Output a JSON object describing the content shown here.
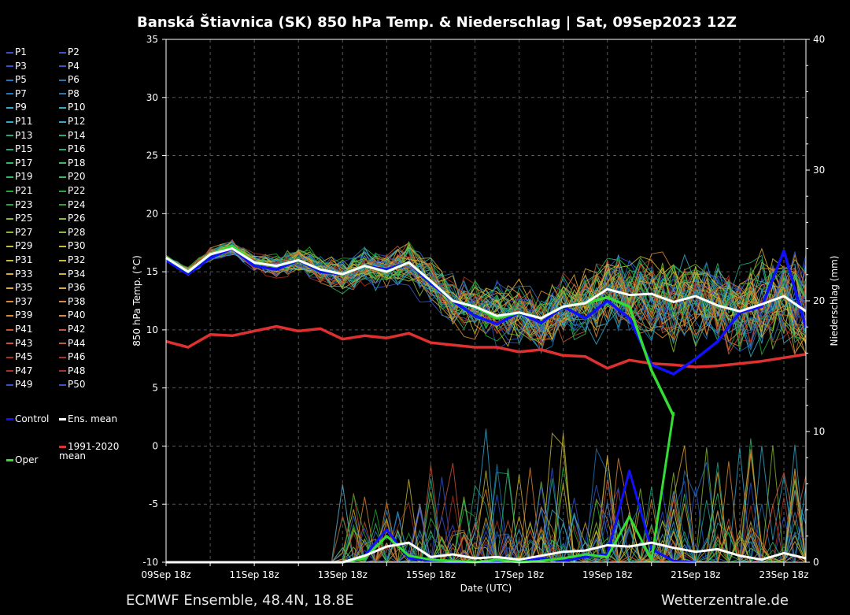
{
  "title": "Banská Štiavnica  (SK)  850 hPa Temp. & Niederschlag | Sat, 09Sep2023 12Z",
  "footer": {
    "left": "ECMWF Ensemble, 48.4N, 18.8E",
    "right": "Wetterzentrale.de"
  },
  "legend": {
    "members": [
      "P1",
      "P2",
      "P3",
      "P4",
      "P5",
      "P6",
      "P7",
      "P8",
      "P9",
      "P10",
      "P11",
      "P12",
      "P13",
      "P14",
      "P15",
      "P16",
      "P17",
      "P18",
      "P19",
      "P20",
      "P21",
      "P22",
      "P23",
      "P24",
      "P25",
      "P26",
      "P27",
      "P28",
      "P29",
      "P30",
      "P31",
      "P32",
      "P33",
      "P34",
      "P35",
      "P36",
      "P37",
      "P38",
      "P39",
      "P40",
      "P41",
      "P42",
      "P43",
      "P44",
      "P45",
      "P46",
      "P47",
      "P48",
      "P49",
      "P50"
    ],
    "control": "Control",
    "ens_mean": "Ens. mean",
    "clim_mean": "1991-2020 mean",
    "oper": "Oper"
  },
  "colors": {
    "control": "#1010ff",
    "ens_mean": "#ffffff",
    "clim": "#e03030",
    "oper": "#33dd33",
    "members": [
      "#3355cc",
      "#2277bb",
      "#33aacc",
      "#22aa88",
      "#33bb66",
      "#22aa33",
      "#88bb33",
      "#ccbb33",
      "#ddaa33",
      "#dd8833",
      "#cc5533",
      "#aa3322"
    ]
  },
  "chart_data": {
    "type": "line",
    "x_ticks": [
      "09Sep 18z",
      "11Sep 18z",
      "13Sep 18z",
      "15Sep 18z",
      "17Sep 18z",
      "19Sep 18z",
      "21Sep 18z",
      "23Sep 18z"
    ],
    "xlabel": "Date (UTC)",
    "ylabel_left": "850 hPa Temp. (°C)",
    "ylabel_right": "Niederschlag (mm)",
    "ylim_left": [
      -10,
      35
    ],
    "ylim_right": [
      0,
      40
    ],
    "yticks_left": [
      -10,
      -5,
      0,
      5,
      10,
      15,
      20,
      25,
      30,
      35
    ],
    "yticks_right": [
      0,
      10,
      20,
      30,
      40
    ],
    "x_range_days": [
      0,
      14.5
    ],
    "grid": true,
    "series": [
      {
        "name": "Ens. mean",
        "axis": "left",
        "x": [
          0,
          0.5,
          1,
          1.5,
          2,
          2.5,
          3,
          3.5,
          4,
          4.5,
          5,
          5.5,
          6,
          6.5,
          7,
          7.5,
          8,
          8.5,
          9,
          9.5,
          10,
          10.5,
          11,
          11.5,
          12,
          12.5,
          13,
          13.5,
          14,
          14.5
        ],
        "values": [
          16.2,
          15.0,
          16.5,
          17.0,
          15.8,
          15.5,
          16.0,
          15.2,
          14.8,
          15.5,
          15.0,
          15.8,
          14.2,
          12.5,
          12.0,
          11.2,
          11.5,
          11.0,
          12.0,
          12.3,
          13.5,
          13.0,
          13.1,
          12.4,
          12.9,
          12.1,
          11.6,
          12.2,
          12.9,
          11.6
        ]
      },
      {
        "name": "Control",
        "axis": "left",
        "x": [
          0,
          0.5,
          1,
          1.5,
          2,
          2.5,
          3,
          3.5,
          4,
          4.5,
          5,
          5.5,
          6,
          6.5,
          7,
          7.5,
          8,
          8.5,
          9,
          9.5,
          10,
          10.5,
          11,
          11.5,
          12,
          12.5,
          13,
          13.5,
          14,
          14.5
        ],
        "values": [
          16.0,
          14.8,
          16.2,
          17.0,
          15.5,
          15.2,
          16.0,
          15.0,
          14.8,
          15.5,
          15.2,
          15.8,
          14.0,
          12.5,
          11.2,
          10.5,
          11.5,
          10.6,
          12.0,
          11.0,
          12.5,
          11.0,
          7.0,
          6.2,
          7.5,
          9.0,
          11.5,
          12.0,
          16.8,
          10.2
        ]
      },
      {
        "name": "Oper",
        "axis": "left",
        "x": [
          0,
          0.5,
          1,
          1.5,
          2,
          2.5,
          3,
          3.5,
          4,
          4.5,
          5,
          5.5,
          6,
          6.5,
          7,
          7.5,
          8,
          8.5,
          9,
          9.5,
          10,
          10.5,
          11,
          11.5
        ],
        "values": [
          16.2,
          15.0,
          16.5,
          17.2,
          15.8,
          15.5,
          16.0,
          15.2,
          14.8,
          15.5,
          15.0,
          15.8,
          14.2,
          12.5,
          12.0,
          11.0,
          11.5,
          11.0,
          12.0,
          12.3,
          12.8,
          12.0,
          6.5,
          2.6
        ]
      },
      {
        "name": "1991-2020 mean",
        "axis": "left",
        "x": [
          0,
          0.5,
          1,
          1.5,
          2,
          2.5,
          3,
          3.5,
          4,
          4.5,
          5,
          5.5,
          6,
          6.5,
          7,
          7.5,
          8,
          8.5,
          9,
          9.5,
          10,
          10.5,
          11,
          11.5,
          12,
          12.5,
          13,
          13.5,
          14,
          14.5
        ],
        "values": [
          9.0,
          8.5,
          9.6,
          9.5,
          9.9,
          10.3,
          9.9,
          10.1,
          9.2,
          9.5,
          9.3,
          9.7,
          8.9,
          8.7,
          8.5,
          8.5,
          8.1,
          8.3,
          7.8,
          7.7,
          6.7,
          7.4,
          7.1,
          7.0,
          6.8,
          6.9,
          7.1,
          7.3,
          7.6,
          7.9
        ]
      },
      {
        "name": "Ens. mean precip",
        "axis": "right",
        "x": [
          0,
          1,
          2,
          3,
          4,
          4.5,
          5,
          5.5,
          6,
          6.5,
          7,
          7.5,
          8,
          8.5,
          9,
          9.5,
          10,
          10.5,
          11,
          11.5,
          12,
          12.5,
          13,
          13.5,
          14,
          14.5
        ],
        "values": [
          0,
          0,
          0,
          0,
          0,
          0.5,
          1.2,
          1.5,
          0.4,
          0.6,
          0.3,
          0.4,
          0.2,
          0.5,
          0.8,
          0.9,
          1.3,
          1.2,
          1.5,
          1.1,
          0.8,
          1.0,
          0.5,
          0.2,
          0.7,
          0.3
        ]
      },
      {
        "name": "Oper precip",
        "axis": "right",
        "x": [
          0,
          4,
          4.5,
          5,
          5.5,
          6,
          6.5,
          7,
          7.5,
          8,
          8.5,
          9,
          9.5,
          10,
          10.5,
          11,
          11.5
        ],
        "values": [
          0,
          0,
          0.3,
          2.0,
          0.5,
          0.2,
          0.1,
          0,
          0.2,
          0,
          0.1,
          0.3,
          0.6,
          0.4,
          3.5,
          0.2,
          11.5
        ]
      },
      {
        "name": "Control precip",
        "axis": "right",
        "x": [
          0,
          4,
          4.5,
          5,
          5.5,
          6,
          6.5,
          7,
          7.5,
          8,
          8.5,
          9,
          9.5,
          10,
          10.5,
          11,
          11.5,
          12
        ],
        "values": [
          0,
          0,
          0.5,
          2.5,
          0.3,
          0.1,
          0,
          0,
          0,
          0.2,
          0.3,
          0.1,
          0.4,
          0.6,
          7.0,
          1.0,
          0.1,
          0
        ]
      }
    ]
  }
}
